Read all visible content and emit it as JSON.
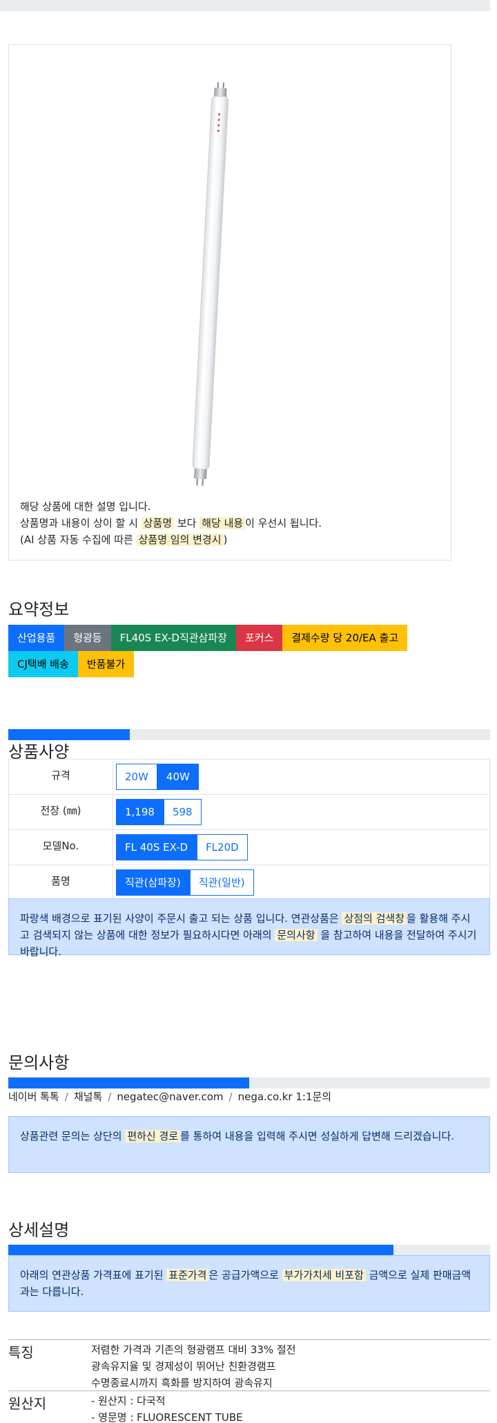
{
  "card": {
    "line1": "해당 상품에 대한 설명 입니다.",
    "line2_a": "상품명과 내용이 상이 할 시 ",
    "line2_mark1": "상품명",
    "line2_b": " 보다 ",
    "line2_mark2": "해당 내용",
    "line2_c": "이 우선시 됩니다.",
    "line3_a": "(AI 상품 자동 수집에 따른 ",
    "line3_mark": "상품명 임의 변경시",
    "line3_b": ")"
  },
  "summary": {
    "title": "요약정보",
    "badges_row1": [
      {
        "label": "산업용품",
        "color": "#0d6efd"
      },
      {
        "label": "형광등",
        "color": "#6c757d"
      },
      {
        "label": "FL40S EX-D직관삼파장",
        "color": "#198754"
      },
      {
        "label": "포커스",
        "color": "#dc3545"
      },
      {
        "label": "결제수량 당 20/EA 출고",
        "color": "#ffc107"
      }
    ],
    "badges_row2": [
      {
        "label": "CJ택배 배송",
        "color": "#0dcaf0"
      },
      {
        "label": "반품불가",
        "color": "#ffc107"
      }
    ]
  },
  "spec": {
    "progress_fraction": 0.25,
    "title": "상품사양",
    "rows": [
      {
        "label": "규격",
        "options": [
          {
            "label": "20W",
            "selected": false
          },
          {
            "label": "40W",
            "selected": true
          }
        ]
      },
      {
        "label": "전장 (㎜)",
        "options": [
          {
            "label": "1,198",
            "selected": true
          },
          {
            "label": "598",
            "selected": false
          }
        ]
      },
      {
        "label": "모델No.",
        "options": [
          {
            "label": "FL 40S EX-D",
            "selected": true
          },
          {
            "label": "FL20D",
            "selected": false
          }
        ]
      },
      {
        "label": "품명",
        "options": [
          {
            "label": "직관(삼파장)",
            "selected": true
          },
          {
            "label": "직관(일반)",
            "selected": false
          }
        ]
      }
    ],
    "notice_a": "파랑색 배경으로 표기된 사양이 주문시 출고 되는 상품 입니다. 연관상품은 ",
    "notice_mark1": "상점의 검색창",
    "notice_b": "을 활용해 주시고 검색되지 않는 상품에 대한 정보가 필요하시다면 아래의 ",
    "notice_mark2": "문의사항",
    "notice_c": " 을 참고하여 내용을 전달하여 주시기 바랍니다."
  },
  "inquiry": {
    "title": "문의사항",
    "progress_fraction": 0.5,
    "contacts": [
      "네이버 톡톡",
      "채널톡",
      "negatec@naver.com",
      "nega.co.kr 1:1문의"
    ],
    "separator": "/",
    "notice_a": "상품관련 문의는 상단의 ",
    "notice_mark": "편하신 경로",
    "notice_b": "를 통하여 내용을 입력해 주시면 성실하게 답변해 드리겠습니다."
  },
  "detail": {
    "title": "상세설명",
    "progress_fraction": 0.8,
    "notice_a": "아래의 연관상품 가격표에 표기된 ",
    "notice_mark1": "표준가격",
    "notice_b": "은 공급가액으로 ",
    "notice_mark2": "부가가치세 비포함",
    "notice_c": " 금액으로 실제 판매금액과는 다릅니다.",
    "features_title": "특징",
    "features": [
      "저렴한 가격과 기존의 형광램프 대비 33% 절전",
      "광속유지율 및 경제성이 뛰어난 친환경램프",
      "수명종료시까지 흑화를 방지하여 광속유지"
    ],
    "origin_title": "원산지",
    "origin": [
      "- 원산지 : 다국적",
      "- 영문명 : FLUORESCENT TUBE"
    ]
  }
}
